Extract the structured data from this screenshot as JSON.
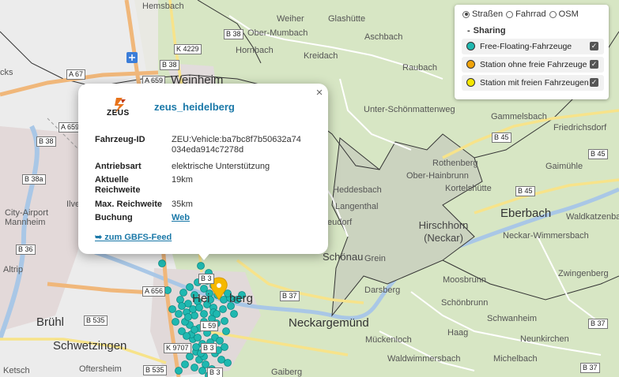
{
  "map": {
    "places": [
      {
        "name": "Hemsbach"
      },
      {
        "name": "Weiher"
      },
      {
        "name": "Glashütte"
      },
      {
        "name": "Ober-Mumbach"
      },
      {
        "name": "Hornbach"
      },
      {
        "name": "Aschbach"
      },
      {
        "name": "Kreidach"
      },
      {
        "name": "Raubach"
      },
      {
        "name": "Weinheim"
      },
      {
        "name": "Unter-Schönmattenweg"
      },
      {
        "name": "Gammelsbach"
      },
      {
        "name": "Friedrichsdorf"
      },
      {
        "name": "Rothenberg"
      },
      {
        "name": "Ober-Hainbrunn"
      },
      {
        "name": "Kortelshütte"
      },
      {
        "name": "Heddesbach"
      },
      {
        "name": "Langenthal"
      },
      {
        "name": "Gaimühle"
      },
      {
        "name": "Eberbach"
      },
      {
        "name": "Waldkatzenbach"
      },
      {
        "name": "Neckar-Wimmersbach"
      },
      {
        "name": "Hirschhorn (Neckar)"
      },
      {
        "name": "Schönau"
      },
      {
        "name": "Grein"
      },
      {
        "name": "Darsberg"
      },
      {
        "name": "Moosbrunn"
      },
      {
        "name": "Zwingenberg"
      },
      {
        "name": "Schönbrunn"
      },
      {
        "name": "Schwanheim"
      },
      {
        "name": "Neckargemünd"
      },
      {
        "name": "Mückenloch"
      },
      {
        "name": "Haag"
      },
      {
        "name": "Neunkirchen"
      },
      {
        "name": "Waldwimmersbach"
      },
      {
        "name": "Michelbach"
      },
      {
        "name": "Gaiberg"
      },
      {
        "name": "Brühl"
      },
      {
        "name": "Schwetzingen"
      },
      {
        "name": "Oftersheim"
      },
      {
        "name": "Ketsch"
      },
      {
        "name": "Altrip"
      },
      {
        "name": "City-Airport"
      },
      {
        "name": "Mannheim"
      },
      {
        "name": "Ilve"
      },
      {
        "name": "eudorf"
      },
      {
        "name": "cks"
      },
      {
        "name": "Hei"
      },
      {
        "name": "berg"
      }
    ],
    "roads": [
      "K 4229",
      "B 38",
      "B 38",
      "A 67",
      "A 659",
      "A 659",
      "B 38",
      "B 38a",
      "B 36",
      "B 45",
      "B 45",
      "B 45",
      "B 3",
      "A 656",
      "B 37",
      "B 37",
      "B 535",
      "B 535",
      "K 9707",
      "B 3",
      "B 3",
      "L 59",
      "B 37"
    ],
    "marker_count_free_floating": 80,
    "colors": {
      "free_floating": "#1fb8b0",
      "station_empty": "#f0a30a",
      "station_available": "#f5e600",
      "selected_marker": "#f5b800"
    }
  },
  "popup": {
    "logo_text": "ZEUS",
    "operator": "zeus_heidelberg",
    "close_label": "×",
    "rows": [
      {
        "key": "Fahrzeug-ID",
        "value": "ZEU:Vehicle:ba7bc8f7b50632a74034eda914c7278d"
      },
      {
        "key": "Antriebsart",
        "value": "elektrische Unterstützung"
      },
      {
        "key": "Aktuelle Reichweite",
        "value": "19km"
      },
      {
        "key": "Max. Reichweite",
        "value": "35km"
      },
      {
        "key": "Buchung",
        "value": "Web"
      }
    ],
    "feed_link": "➥ zum GBFS-Feed"
  },
  "layers": {
    "base": [
      {
        "label": "Straßen",
        "selected": true
      },
      {
        "label": "Fahrrad",
        "selected": false
      },
      {
        "label": "OSM",
        "selected": false
      }
    ],
    "group_label": "Sharing",
    "items": [
      {
        "label": "Free-Floating-Fahrzeuge",
        "color": "#1fb8b0",
        "checked": true
      },
      {
        "label": "Station ohne freie Fahrzeuge",
        "color": "#f0a30a",
        "checked": true
      },
      {
        "label": "Station mit freien Fahrzeugen",
        "color": "#f5e600",
        "checked": true
      }
    ],
    "check_glyph": "✓"
  }
}
